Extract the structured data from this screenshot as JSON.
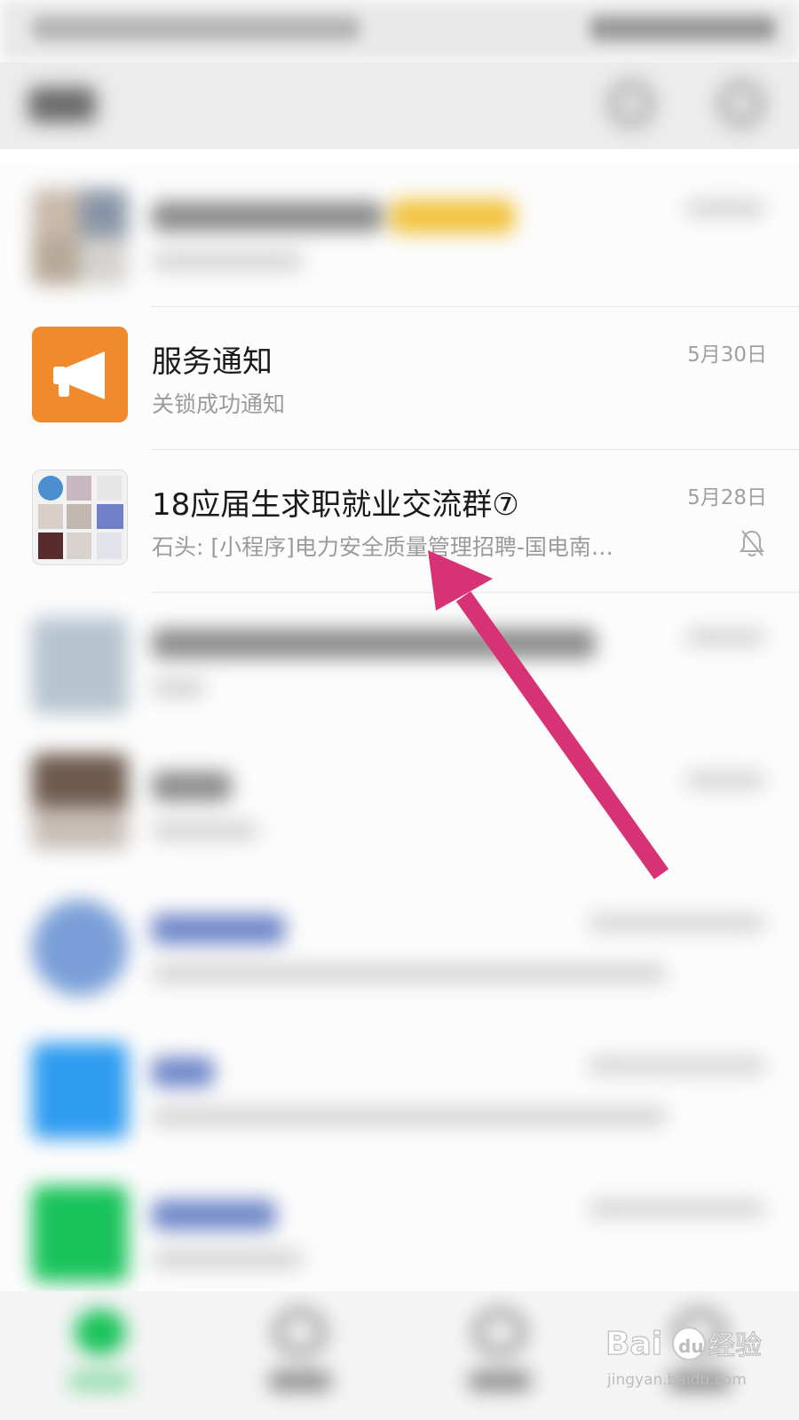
{
  "chats": [
    {
      "name": "",
      "preview": "",
      "time": ""
    },
    {
      "name": "服务通知",
      "preview": "关锁成功通知",
      "time": "5月30日",
      "avatar_color": "#f18a2c",
      "avatar_icon": "megaphone-icon"
    },
    {
      "name": "18应届生求职就业交流群⑦",
      "preview": "石头: [小程序]电力安全质量管理招聘-国电南…",
      "time": "5月28日",
      "muted": true,
      "muted_icon": "bell-off-icon"
    },
    {
      "name": "",
      "preview": "",
      "time": ""
    },
    {
      "name": "",
      "preview": "",
      "time": ""
    },
    {
      "name": "",
      "preview": "",
      "time": ""
    },
    {
      "name": "",
      "preview": "",
      "time": ""
    },
    {
      "name": "",
      "preview": "",
      "time": ""
    }
  ],
  "annotation": {
    "color": "#d83276",
    "shape": "arrow"
  },
  "watermark": {
    "brand": "Baidu",
    "text": "经验",
    "url": "jingyan.baidu.com"
  },
  "colors": {
    "accent_green": "#19c35a",
    "service_orange": "#f18a2c"
  }
}
